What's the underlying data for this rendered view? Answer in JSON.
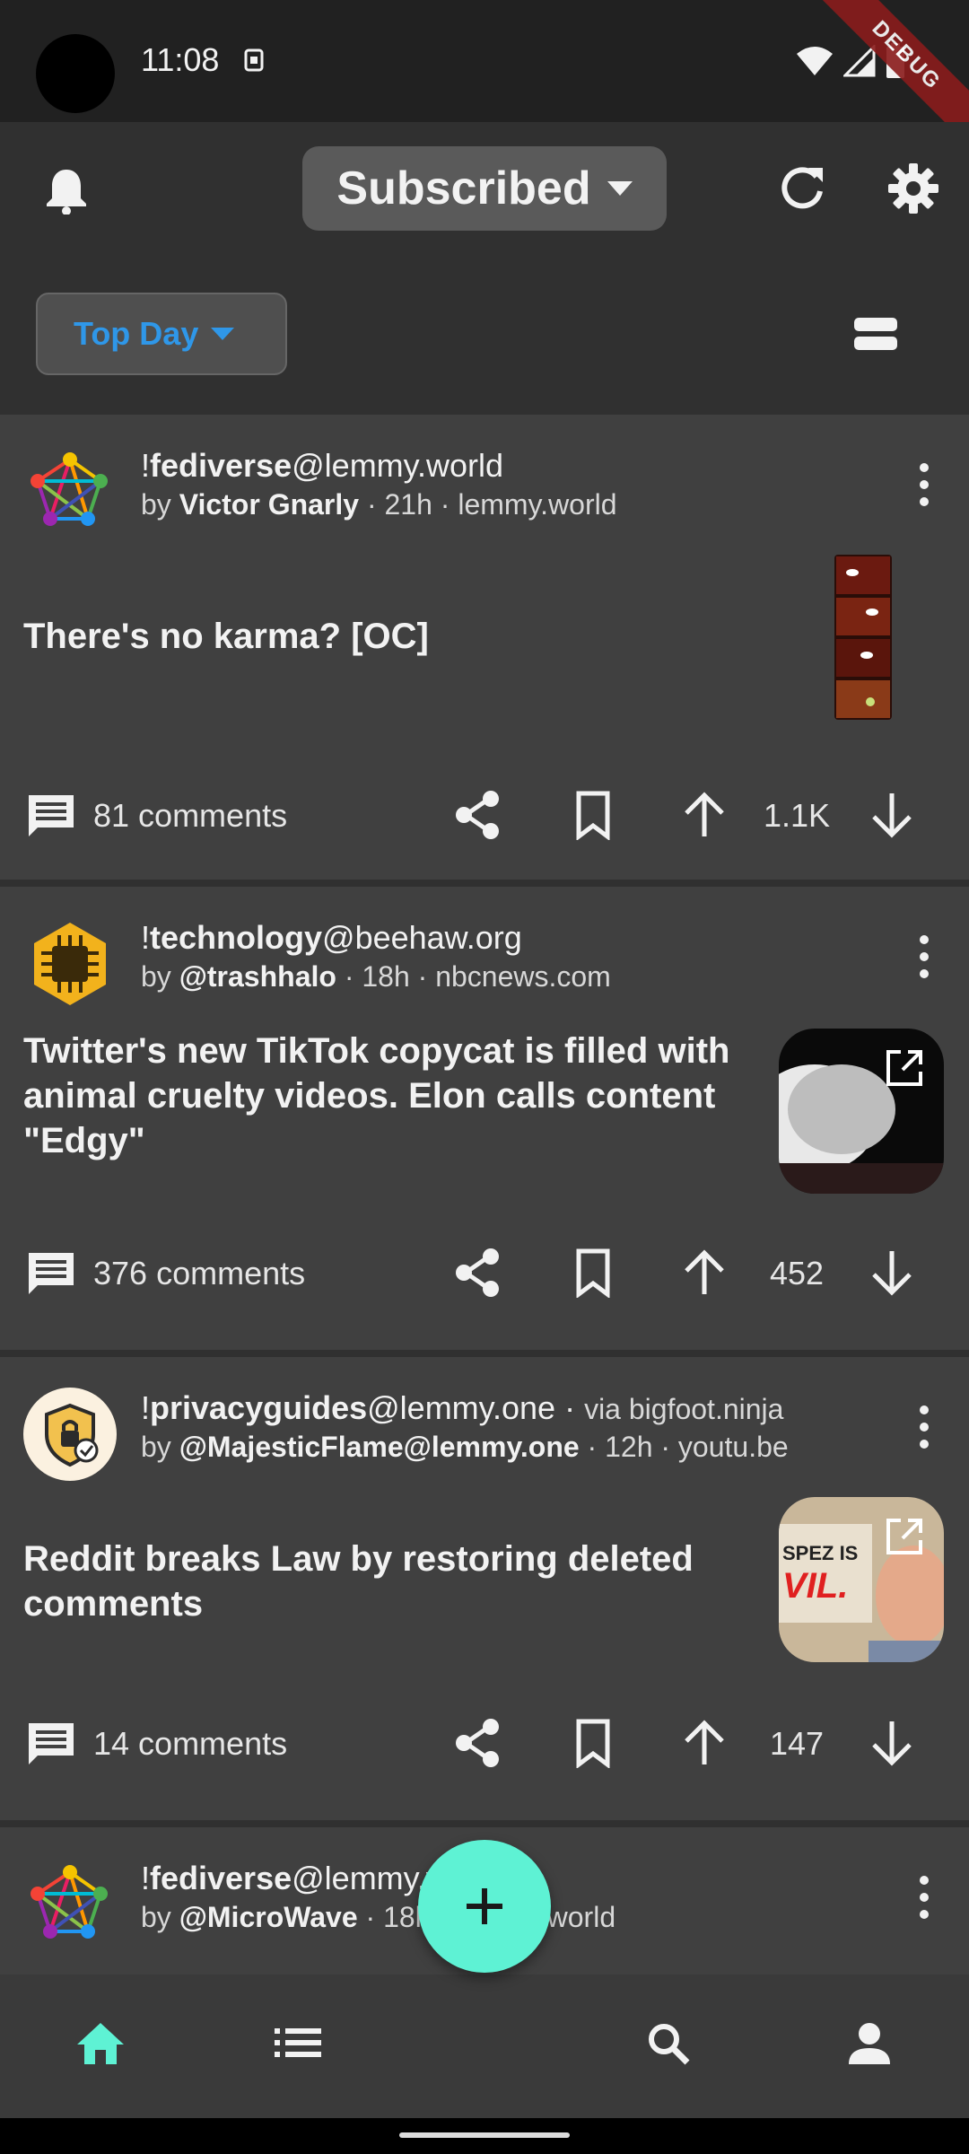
{
  "status_bar": {
    "time": "11:08",
    "debug_label": "DEBUG"
  },
  "app_bar": {
    "feed_label": "Subscribed",
    "icons": [
      "bell-icon",
      "refresh-icon",
      "gear-icon"
    ]
  },
  "sort": {
    "label": "Top Day",
    "view_toggle_icon": "view-compact-icon"
  },
  "posts": [
    {
      "community": "fediverse",
      "instance": "@lemmy.world",
      "via": "",
      "author": "Victor Gnarly",
      "age": "21h",
      "domain": "lemmy.world",
      "title": "There's no karma? [OC]",
      "comments": "81 comments",
      "score": "1.1K"
    },
    {
      "community": "technology",
      "instance": "@beehaw.org",
      "via": "",
      "author": "@trashhalo",
      "age": "18h",
      "domain": "nbcnews.com",
      "title": "Twitter's new TikTok copycat is filled with animal cruelty videos. Elon calls content \"Edgy\"",
      "comments": "376 comments",
      "score": "452"
    },
    {
      "community": "privacyguides",
      "instance": "@lemmy.one",
      "via": "via bigfoot.ninja",
      "author": "@MajesticFlame@lemmy.one",
      "age": "12h",
      "domain": "youtu.be",
      "title": "Reddit breaks Law by restoring deleted comments",
      "comments": "14 comments",
      "score": "147",
      "thumb_text": "SPEZ IS\nVIL."
    },
    {
      "community": "fediverse",
      "instance": "@lemmy.world",
      "author": "@MicroWave",
      "age": "18h",
      "domain": "lemmy.world"
    }
  ],
  "bottom_nav": {
    "items": [
      "home-icon",
      "list-icon",
      "search-icon",
      "account-icon"
    ]
  },
  "colors": {
    "accent": "#2f97e8",
    "fab": "#5ef2d4",
    "background": "#303030",
    "card": "#404040"
  }
}
